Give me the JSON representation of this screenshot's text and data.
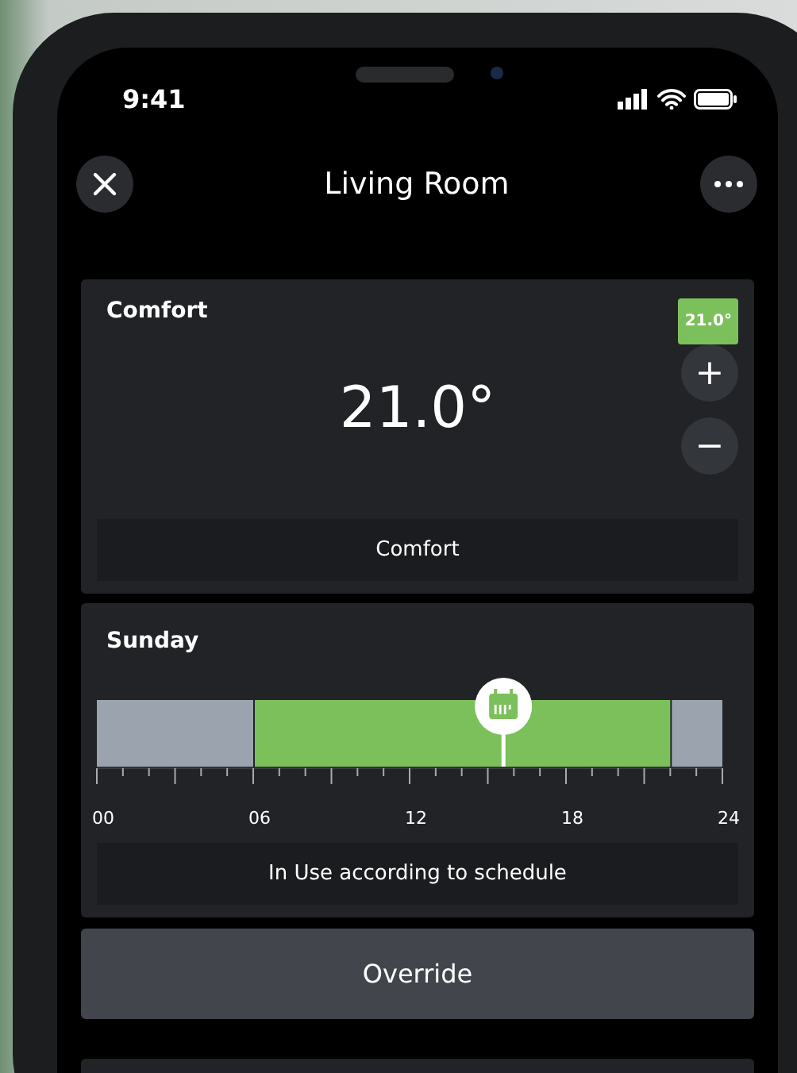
{
  "status_bar": {
    "time": "9:41"
  },
  "header": {
    "title": "Living Room"
  },
  "mode_card": {
    "title": "Comfort",
    "badge": "21.0°",
    "temperature": "21.0°",
    "increase": "+",
    "decrease": "−",
    "mode_label": "Comfort"
  },
  "schedule_card": {
    "chart_data": {
      "type": "bar",
      "title": "Sunday",
      "orientation": "horizontal",
      "stacked": true,
      "xlim": [
        0,
        24
      ],
      "series": [
        {
          "color": "#9ba4ae",
          "values": [
            6
          ]
        },
        {
          "color": "#7cc05b",
          "values": [
            16
          ]
        },
        {
          "color": "#9ba4ae",
          "values": [
            2
          ]
        }
      ],
      "xticks": [
        {
          "value": 0,
          "label": "00"
        },
        {
          "value": 6,
          "label": "06"
        },
        {
          "value": 12,
          "label": "12"
        },
        {
          "value": 18,
          "label": "18"
        },
        {
          "value": 24,
          "label": "24"
        }
      ]
    },
    "now_marker": {
      "level": 0.65
    },
    "status": "In Use according to schedule"
  },
  "override_button": "Override"
}
